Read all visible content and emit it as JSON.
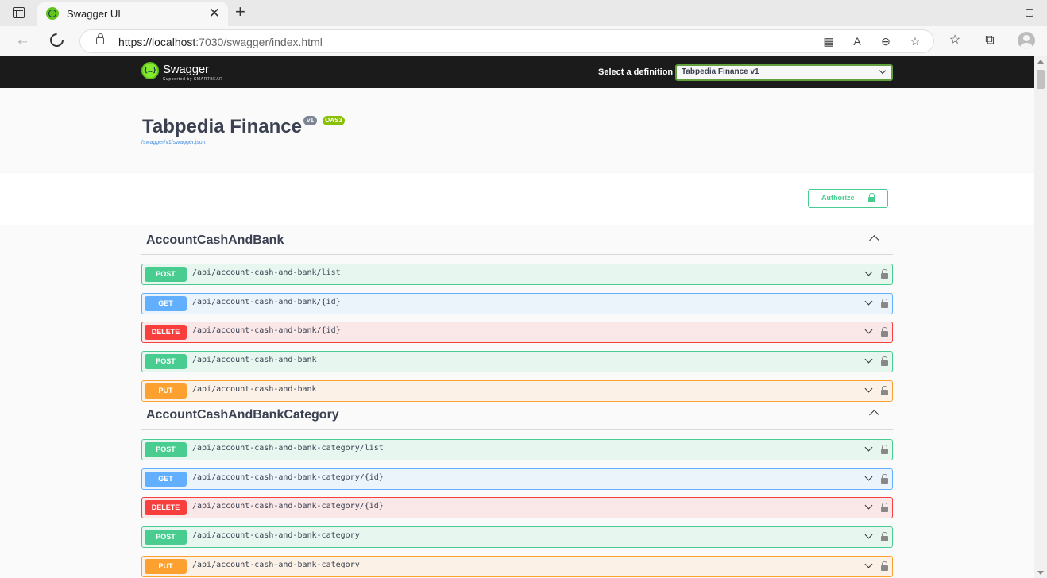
{
  "browser": {
    "tab_title": "Swagger UI",
    "url_host": "https://localhost",
    "url_rest": ":7030/swagger/index.html"
  },
  "swagger": {
    "logo_text": "Swagger",
    "logo_sub": "Supported by SMARTBEAR",
    "definition_label": "Select a definition",
    "definition_value": "Tabpedia Finance v1",
    "title": "Tabpedia Finance",
    "version": "v1",
    "oas": "OAS3",
    "spec_link": "/swagger/v1/swagger.json",
    "authorize_label": "Authorize"
  },
  "tags": [
    {
      "name": "AccountCashAndBank",
      "operations": [
        {
          "method": "POST",
          "path": "/api/account-cash-and-bank/list"
        },
        {
          "method": "GET",
          "path": "/api/account-cash-and-bank/{id}"
        },
        {
          "method": "DELETE",
          "path": "/api/account-cash-and-bank/{id}"
        },
        {
          "method": "POST",
          "path": "/api/account-cash-and-bank"
        },
        {
          "method": "PUT",
          "path": "/api/account-cash-and-bank"
        }
      ]
    },
    {
      "name": "AccountCashAndBankCategory",
      "operations": [
        {
          "method": "POST",
          "path": "/api/account-cash-and-bank-category/list"
        },
        {
          "method": "GET",
          "path": "/api/account-cash-and-bank-category/{id}"
        },
        {
          "method": "DELETE",
          "path": "/api/account-cash-and-bank-category/{id}"
        },
        {
          "method": "POST",
          "path": "/api/account-cash-and-bank-category"
        },
        {
          "method": "PUT",
          "path": "/api/account-cash-and-bank-category"
        }
      ]
    }
  ],
  "colors": {
    "post": "#49cc90",
    "get": "#61affe",
    "delete": "#f93e3e",
    "put": "#fca130"
  }
}
